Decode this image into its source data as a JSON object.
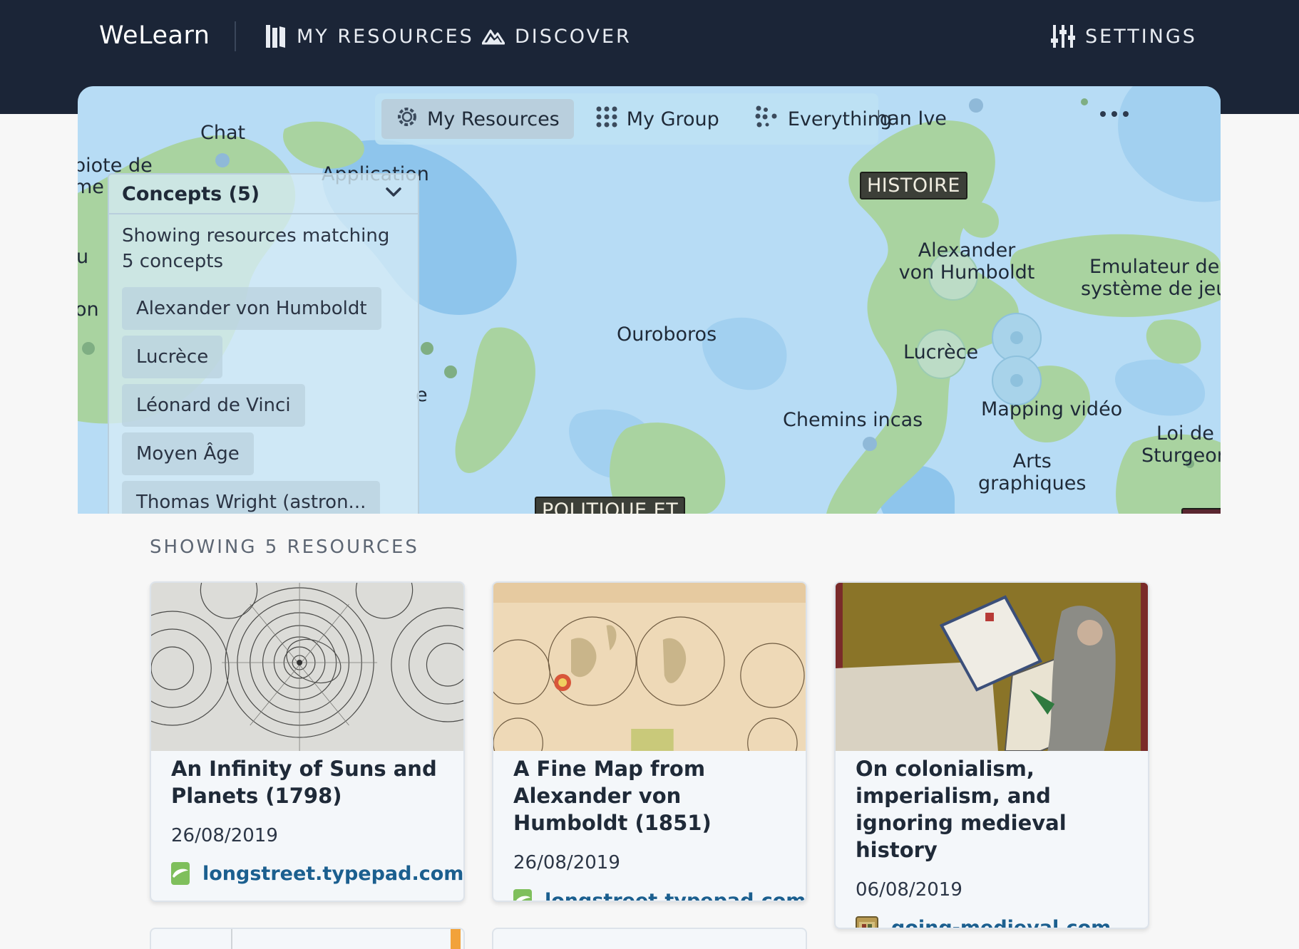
{
  "nav": {
    "brand": "WeLearn",
    "my_resources": "MY RESOURCES",
    "discover": "DISCOVER",
    "settings": "SETTINGS"
  },
  "map": {
    "scope_options": [
      "My Resources",
      "My Group",
      "Everything"
    ],
    "active_scope": "My Resources",
    "labels": {
      "chat": "Chat",
      "ajiote": "biote de",
      "me": "me",
      "application": "Application",
      "u": "u",
      "on": "on",
      "han_ive": "han Ive",
      "humboldt_1": "Alexander",
      "humboldt_2": "von Humboldt",
      "emulateur_1": "Emulateur de",
      "emulateur_2": "système de jeu",
      "ouroboros": "Ouroboros",
      "lucrece": "Lucrèce",
      "mapping": "Mapping vidéo",
      "chemins": "Chemins incas",
      "loi_1": "Loi de",
      "loi_2": "Sturgeon",
      "arts_1": "Arts",
      "arts_2": "graphiques",
      "e_frag": "e"
    },
    "tags": {
      "histoire": "HISTOIRE",
      "politique": "POLITIQUE ET"
    }
  },
  "concepts": {
    "title": "Concepts (5)",
    "description": "Showing resources matching 5 concepts",
    "items": [
      "Alexander von Humboldt",
      "Lucrèce",
      "Léonard de Vinci",
      "Moyen Âge",
      "Thomas Wright (astron..."
    ]
  },
  "resources": {
    "section_title": "SHOWING 5 RESOURCES",
    "cards": [
      {
        "title": "An Infinity of Suns and Planets (1798)",
        "date": "26/08/2019",
        "source": "longstreet.typepad.com"
      },
      {
        "title": "A Fine Map from Alexander von Humboldt (1851)",
        "date": "26/08/2019",
        "source": "longstreet.typepad.com"
      },
      {
        "title": "On colonialism, imperialism, and ignoring medieval history",
        "date": "06/08/2019",
        "source": "going-medieval.com"
      }
    ]
  },
  "icons": {
    "my_resources": "books-icon",
    "discover": "mountain-icon",
    "settings": "sliders-icon",
    "scope_my_resources": "gear-icon",
    "scope_my_group": "dots-grid-icon",
    "scope_everything": "dots-scatter-icon",
    "concepts_toggle": "chevron-down-icon",
    "more": "more-horizontal-icon"
  },
  "colors": {
    "nav_bg": "#1b2537",
    "water": "#b7dcf5",
    "deep_water": "#8ec5ec",
    "land": "#a9d3a0",
    "link": "#1b5f8f"
  }
}
